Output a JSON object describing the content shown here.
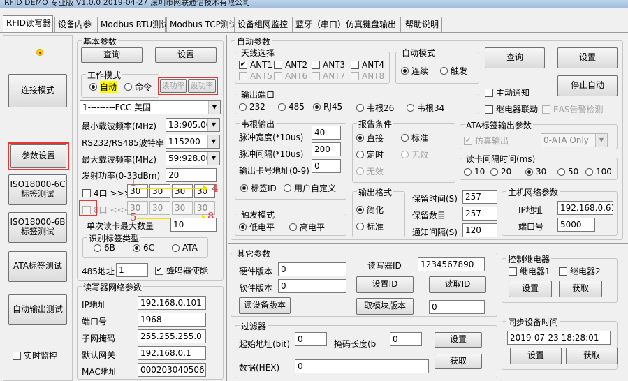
{
  "window": {
    "title": "RFID DEMO 专业版 V1.0.0  2019-04-27  深圳市网联通信技术有限公司"
  },
  "tabs": [
    {
      "label": "RFID读写器"
    },
    {
      "label": "设备内参"
    },
    {
      "label": "Modbus RTU测试"
    },
    {
      "label": "Modbus TCP测试"
    },
    {
      "label": "设备组网监控"
    },
    {
      "label": "蓝牙（串口）仿真键盘输出"
    },
    {
      "label": "帮助说明"
    }
  ],
  "left_nav": {
    "connect_mode": "连接模式",
    "param_settings": "参数设置",
    "iso6c_line1": "ISO18000-6C",
    "iso6c_line2": "标签测试",
    "iso6b_line1": "ISO18000-6B",
    "iso6b_line2": "标签测试",
    "ata_test": "ATA标签测试",
    "auto_output_test": "自动输出测试",
    "realtime_monitor": "实时监控"
  },
  "basic": {
    "title": "基本参数",
    "query": "查询",
    "set": "设置",
    "work_mode_title": "工作模式",
    "mode_auto": "自动",
    "mode_cmd": "命令",
    "read_power": "读功率",
    "write_power": "设功率",
    "region": "1---------FCC   美国",
    "min_freq_label": "最小载波频率(MHz)",
    "min_freq": "13:905.00",
    "baud_label": "RS232/RS485波特率",
    "baud": "115200",
    "max_freq_label": "最大载波频率(MHz)",
    "max_freq": "59:928.00",
    "tx_power_label": "发射功率(0-33dBm)",
    "tx_power": "20",
    "ant4_label": "4口 >>>>",
    "ant4_values": [
      "30",
      "30",
      "30",
      "30"
    ],
    "ant8_label": "8口 <<<<",
    "ant8_values": [
      "30",
      "30",
      "30",
      "30"
    ],
    "ann_1": "1",
    "ann_4": "4",
    "ann_5": "5",
    "ann_8": "8",
    "max_read_label": "单次读卡最大数量",
    "max_read": "10",
    "tag_type_title": "识别标签类型",
    "tag_6b": "6B",
    "tag_6c": "6C",
    "tag_ata": "ATA",
    "addr485_label": "485地址",
    "addr485": "1",
    "buzzer": "蜂鸣器使能"
  },
  "net": {
    "title": "读写器网络参数",
    "ip_label": "IP地址",
    "ip": "192.168.0.101",
    "port_label": "端口号",
    "port": "1968",
    "mask_label": "子网掩码",
    "mask": "255.255.255.0",
    "gateway_label": "默认网关",
    "gateway": "192.168.0.1",
    "mac_label": "MAC地址",
    "mac": "000203040506"
  },
  "auto": {
    "title": "自动参数",
    "antenna_title": "天线选择",
    "ants": [
      "ANT1",
      "ANT2",
      "ANT3",
      "ANT4",
      "ANT5",
      "ANT6",
      "ANT7",
      "ANT8"
    ],
    "auto_mode_title": "自动模式",
    "continuous": "连续",
    "trigger": "触发",
    "query": "查询",
    "set": "设置",
    "active_notify": "主动通知",
    "stop_auto": "停止自动",
    "relay_link": "继电器联动",
    "eas_alarm": "EAS告警检测",
    "output_port_title": "输出端口",
    "ports": [
      "232",
      "485",
      "RJ45",
      "韦根26",
      "韦根34"
    ],
    "wiegand_title": "韦根输出",
    "pulse_width_label": "脉冲宽度(*10us)",
    "pulse_width": "40",
    "pulse_interval_label": "脉冲间隔(*10us)",
    "pulse_interval": "200",
    "card_addr_label": "输出卡号地址(0-9)",
    "card_addr": "0",
    "tag_id": "标签ID",
    "user_def": "用户自定义",
    "report_title": "报告条件",
    "direct": "直接",
    "standard": "标准",
    "timed": "定时",
    "none1": "无效",
    "none2": "无效",
    "ata_out_title": "ATA标签输出参数",
    "sim_output": "仿真输出",
    "ata_select": "0-ATA Only",
    "interval_title": "读卡间隔时间(ms)",
    "intervals": [
      "10",
      "20",
      "30",
      "50",
      "100"
    ],
    "trigger_mode_title": "触发模式",
    "low_level": "低电平",
    "high_level": "高电平",
    "out_fmt_title": "输出格式",
    "simplified": "简化",
    "std_fmt": "标准",
    "hold_time_label": "保留时间(S)",
    "hold_time": "257",
    "hold_count_label": "保留数目",
    "hold_count": "257",
    "notify_interval_label": "通知间隔(S)",
    "notify_interval": "120",
    "host_title": "主机网络参数",
    "host_ip_label": "IP地址",
    "host_ip": "192.168.0.61",
    "host_port_label": "端口号",
    "host_port": "5000"
  },
  "other": {
    "title": "其它参数",
    "hw_label": "硬件版本",
    "hw": "0",
    "sw_label": "软件版本",
    "sw": "0",
    "read_ver": "读设备版本",
    "reader_id_label": "读写器ID",
    "reader_id": "1234567890",
    "set_id": "设置ID",
    "read_id": "读取ID",
    "module_ver": "取模块版本",
    "module_ver_val": "0",
    "filter_title": "过滤器",
    "start_addr_label": "起始地址(bit)",
    "start_addr": "0",
    "mask_len_label": "掩码长度(b",
    "mask_len": "0",
    "filter_set": "设置",
    "filter_get": "获取",
    "data_label": "数据(HEX)",
    "data": "0"
  },
  "relay": {
    "title": "控制继电器",
    "relay1": "继电器1",
    "relay2": "继电器2",
    "set": "设置",
    "get": "获取"
  },
  "sync": {
    "title": "同步设备时间",
    "datetime": "2019-07-23 18:28:01",
    "set": "设置",
    "get": "获取"
  }
}
